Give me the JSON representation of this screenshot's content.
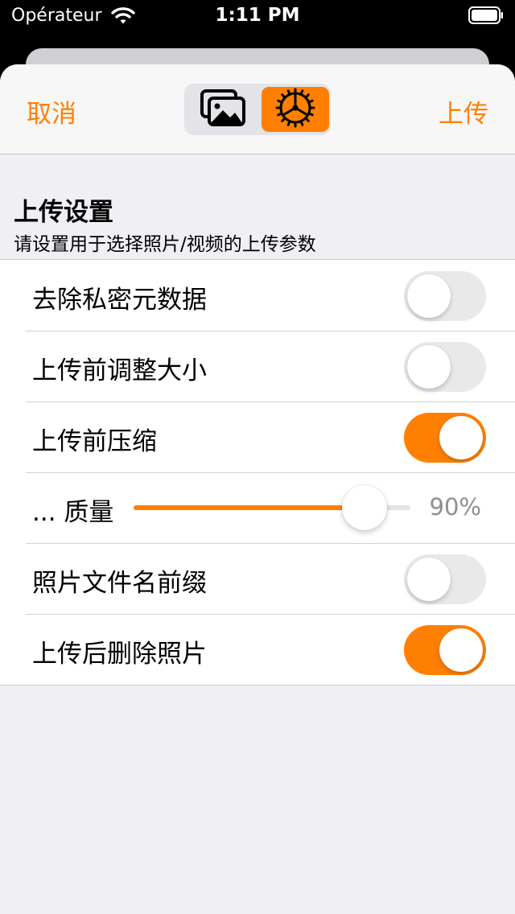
{
  "status_bar": {
    "carrier": "Opérateur",
    "time": "1:11 PM"
  },
  "nav": {
    "cancel_label": "取消",
    "upload_label": "上传",
    "segments": [
      "photos-icon",
      "settings-gear-icon"
    ],
    "selected_segment": 1
  },
  "header": {
    "title": "上传设置",
    "subtitle": "请设置用于选择照片/视频的上传参数"
  },
  "rows": {
    "strip_metadata": {
      "label": "去除私密元数据",
      "on": false
    },
    "resize": {
      "label": "上传前调整大小",
      "on": false
    },
    "compress": {
      "label": "上传前压缩",
      "on": true
    },
    "quality": {
      "label": "... 质量",
      "value_text": "90%",
      "value_fraction": 0.9
    },
    "filename_prefix": {
      "label": "照片文件名前缀",
      "on": false
    },
    "delete_after": {
      "label": "上传后删除照片",
      "on": true
    }
  },
  "colors": {
    "accent": "#ff8000",
    "toggle_off": "#e9e9ea",
    "background": "#efeff4"
  }
}
